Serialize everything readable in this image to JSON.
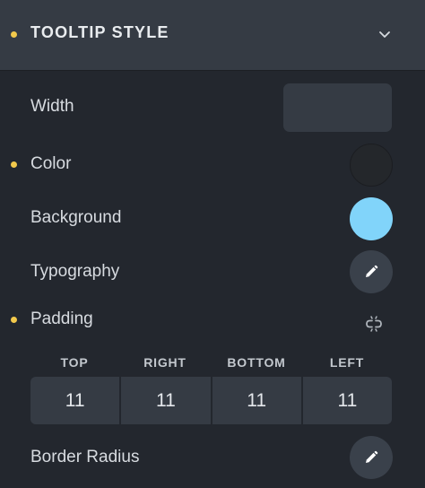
{
  "section": {
    "title": "TOOLTIP STYLE",
    "chevron_icon": "chevron-down-icon"
  },
  "fields": {
    "width": {
      "label": "Width",
      "value": ""
    },
    "color": {
      "label": "Color",
      "swatch": "#24272b"
    },
    "background": {
      "label": "Background",
      "swatch": "#81d4fa"
    },
    "typography": {
      "label": "Typography",
      "icon": "pencil-icon"
    },
    "padding": {
      "label": "Padding",
      "link_icon": "unlink-icon",
      "columns": [
        "TOP",
        "RIGHT",
        "BOTTOM",
        "LEFT"
      ],
      "values": [
        "11",
        "11",
        "11",
        "11"
      ]
    },
    "border_radius": {
      "label": "Border Radius",
      "icon": "pencil-icon"
    }
  },
  "colors": {
    "accent_dot": "#f2c94c",
    "panel_bg": "#23272e",
    "header_bg": "#353b44"
  }
}
